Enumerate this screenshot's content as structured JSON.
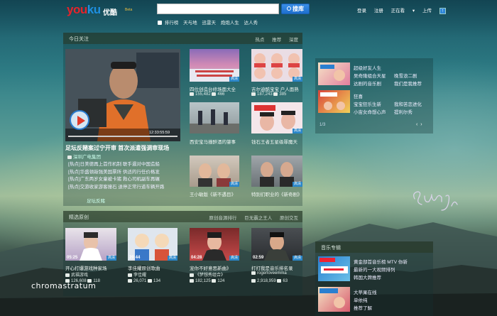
{
  "header": {
    "logo_latin_1": "you",
    "logo_latin_2": "ku",
    "logo_cn": "优酷",
    "logo_tag": "Beta",
    "search_placeholder": "",
    "search_button": "搜库",
    "hotwords": [
      "排行榜",
      "天与地",
      "迅雷天",
      "炮炮人生",
      "达人秀"
    ],
    "user_links": [
      "登录",
      "注册",
      "正在看"
    ],
    "upload_label": "上传"
  },
  "today": {
    "title": "今日关注",
    "tabs": [
      "热点",
      "推荐",
      "深度"
    ],
    "feature": {
      "caption": "足坛反赌案过宁开审 首次派遣强调审现场",
      "source": "深圳广电集团",
      "time": "12:33:55:59",
      "list": [
        "[热点]日美德再上首作机制 联手遏对中国造船",
        "[热点]华盛顿敲强美国票所 供适的行任价格发",
        "[热点]广东两岁女童被卡猪 救心司机副车再碾",
        "[热点]交游收家游客撞石 退停正常行道车辆开路"
      ],
      "more": "足坛反赌"
    },
    "videos": [
      {
        "caption": "四位创造台修场面大全",
        "views": "155,482",
        "comments": "466",
        "badge": "高清"
      },
      {
        "caption": "吉尔迪酷宝宝 户人面熟",
        "views": "187,243",
        "comments": "385",
        "badge": "高清"
      },
      {
        "caption": "西安宝马撞醉酒的肇事",
        "views": "",
        "comments": "",
        "badge": ""
      },
      {
        "caption": "钱石王者五星级罪魔天",
        "views": "",
        "comments": "",
        "badge": "高清"
      },
      {
        "caption": "王小敏版《新不遇目》",
        "views": "",
        "comments": "",
        "badge": "高清"
      },
      {
        "caption": "特别们职业的《新奇剧》",
        "views": "",
        "comments": "",
        "badge": "高清"
      }
    ]
  },
  "right_panel": {
    "items": [
      {
        "title": "超级好友人生",
        "sub1": "吴奇隆组合天星",
        "sub2": "晚雪浪二剧",
        "sub3": "达剧的音乐剧",
        "sub4": "我们是我推荐"
      },
      {
        "title": "狂喜",
        "sub1": "宝宝狂乐生新",
        "sub2": "我和苦恋进化",
        "sub3": "小宙女命想心声",
        "sub4": "提利尔秀"
      }
    ],
    "pager": "1/3"
  },
  "originals": {
    "title": "精选原创",
    "tabs": [
      "原创音源排行",
      "巨无霸之王人",
      "原创交互"
    ],
    "videos": [
      {
        "caption": "开心打爆游戏种家场",
        "author": "武福游戏",
        "views": "126,608",
        "comments": "118",
        "duration": "05:25",
        "badge": "高清"
      },
      {
        "caption": "李佳耀原创歌曲",
        "author": "李佳耀",
        "views": "26,071",
        "comments": "134",
        "duration": "20:44",
        "badge": "高清"
      },
      {
        "caption": "宠你不好意思新曲》",
        "author": "《梦想秀组合》",
        "views": "182,125",
        "comments": "124",
        "duration": "04:28",
        "badge": "高清"
      },
      {
        "caption": "打打我是音乐排名录",
        "author": "rogerloveemma",
        "views": "2,918,959",
        "comments": "63",
        "duration": "02:59",
        "badge": "高清"
      }
    ]
  },
  "side_box": {
    "title": "音乐专辑",
    "items": [
      {
        "title": "黄金部首音乐榜 MTV 你新",
        "sub1": "最新的一大视频排列",
        "sub2": "韩国大牌推荐"
      },
      {
        "title": "大苹果在线",
        "sub1": "单依纯",
        "sub2": "推荐了解"
      }
    ]
  },
  "watermark": "chromastratum",
  "signature": "Suns"
}
